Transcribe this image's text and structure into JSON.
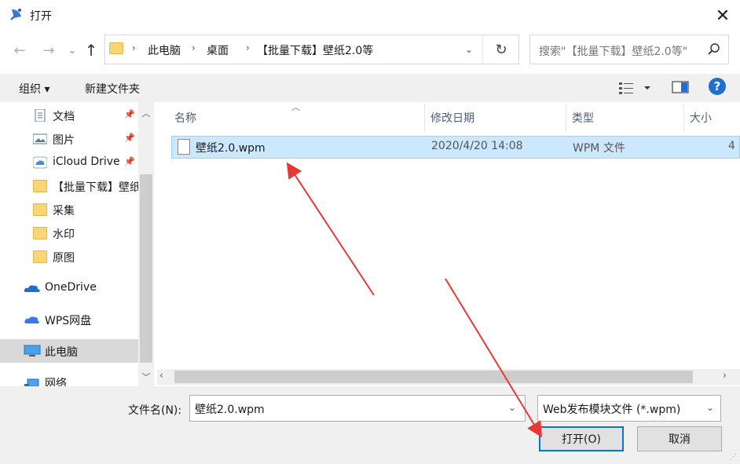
{
  "window": {
    "title": "打开",
    "close_label": "✕"
  },
  "nav": {
    "back": "←",
    "forward": "→",
    "recent": "⌄",
    "up": "↑"
  },
  "address": {
    "crumbs": [
      "此电脑",
      "桌面",
      "【批量下载】壁纸2.0等"
    ],
    "sep": "›",
    "dropdown": "⌄",
    "refresh": "↻"
  },
  "search": {
    "placeholder": "搜索\"【批量下载】壁纸2.0等\""
  },
  "toolbar": {
    "organize": "组织 ▾",
    "new_folder": "新建文件夹",
    "help": "?"
  },
  "sidebar": {
    "items": [
      {
        "label": "文档",
        "icon": "document-icon",
        "pinned": true
      },
      {
        "label": "图片",
        "icon": "picture-icon",
        "pinned": true
      },
      {
        "label": "iCloud Drive",
        "icon": "icloud-icon",
        "pinned": true
      },
      {
        "label": "【批量下载】壁纸",
        "icon": "folder-icon"
      },
      {
        "label": "采集",
        "icon": "folder-icon"
      },
      {
        "label": "水印",
        "icon": "folder-icon"
      },
      {
        "label": "原图",
        "icon": "folder-icon"
      },
      {
        "label": "OneDrive",
        "icon": "onedrive-icon"
      },
      {
        "label": "WPS网盘",
        "icon": "wps-cloud-icon"
      },
      {
        "label": "此电脑",
        "icon": "computer-icon",
        "selected": true
      },
      {
        "label": "网络",
        "icon": "network-icon"
      }
    ]
  },
  "columns": {
    "name": "名称",
    "date": "修改日期",
    "type": "类型",
    "size": "大小"
  },
  "files": [
    {
      "name": "壁纸2.0.wpm",
      "date": "2020/4/20 14:08",
      "type": "WPM 文件",
      "size": "4"
    }
  ],
  "footer": {
    "filename_label": "文件名(N):",
    "filename_value": "壁纸2.0.wpm",
    "filter_value": "Web发布模块文件 (*.wpm)",
    "open_label": "打开(O)",
    "cancel_label": "取消"
  },
  "colors": {
    "accent": "#0078d7",
    "selection": "#cce8ff",
    "annotation_arrow": "#e53935"
  }
}
